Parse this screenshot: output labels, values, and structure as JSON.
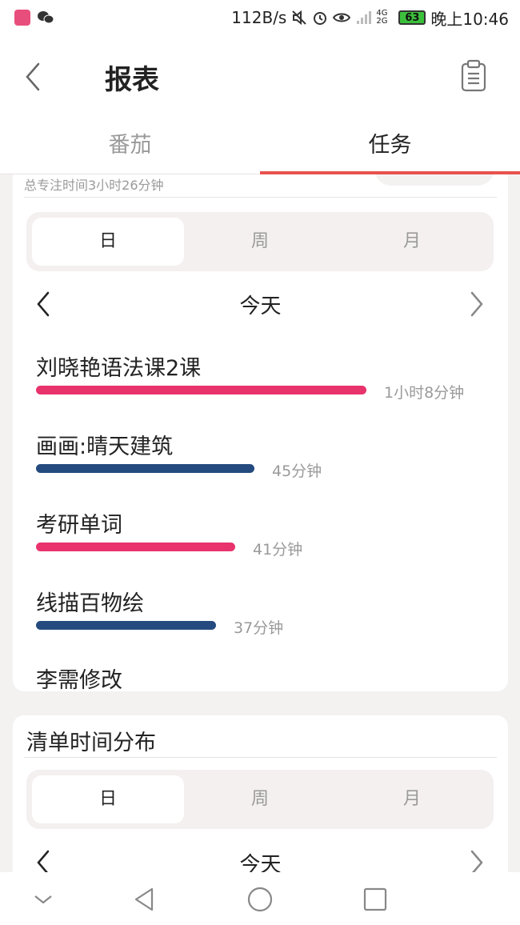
{
  "status_bar": {
    "net_speed": "112B/s",
    "network": "4G 2G",
    "battery": "63",
    "time": "晚上10:46"
  },
  "header": {
    "title": "报表",
    "back_icon": "chevron-left-icon",
    "action_icon": "clipboard-icon"
  },
  "tabs": [
    {
      "label": "番茄",
      "active": false
    },
    {
      "label": "任务",
      "active": true
    }
  ],
  "task_card": {
    "subtitle": "总专注时间3小时26分钟",
    "segments": [
      "日",
      "周",
      "月"
    ],
    "active_segment": "日",
    "date_label": "今天",
    "tasks": [
      {
        "name": "刘晓艳语法课2课",
        "duration": "1小时8分钟",
        "minutes": 68,
        "color": "#e8336d"
      },
      {
        "name": "画画:晴天建筑",
        "duration": "45分钟",
        "minutes": 45,
        "color": "#244a7f"
      },
      {
        "name": "考研单词",
        "duration": "41分钟",
        "minutes": 41,
        "color": "#e8336d"
      },
      {
        "name": "线描百物绘",
        "duration": "37分钟",
        "minutes": 37,
        "color": "#244a7f"
      },
      {
        "name": "李需修改",
        "duration": "",
        "minutes": 0,
        "color": "#e8336d"
      }
    ]
  },
  "list_card": {
    "title": "清单时间分布",
    "segments": [
      "日",
      "周",
      "月"
    ],
    "active_segment": "日",
    "date_label": "今天"
  },
  "colors": {
    "accent": "#e8534f",
    "bar_pink": "#e8336d",
    "bar_navy": "#244a7f"
  }
}
